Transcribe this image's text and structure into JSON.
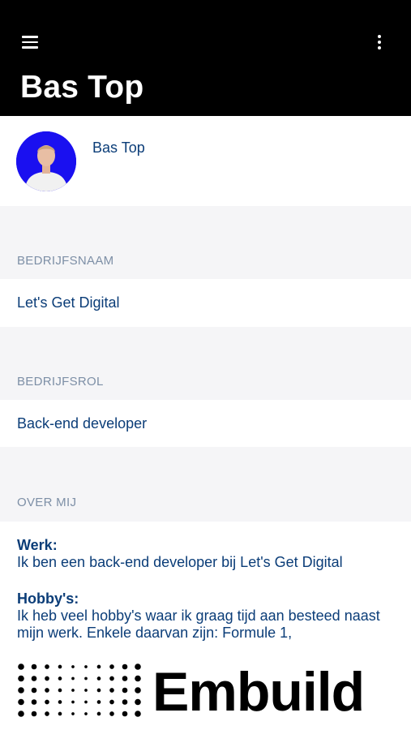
{
  "header": {
    "title": "Bas Top",
    "menu_icon": "hamburger-menu-icon",
    "more_icon": "more-vertical-icon"
  },
  "profile": {
    "name": "Bas Top",
    "avatar_background": "#1a10f0"
  },
  "fields": [
    {
      "label": "BEDRIJFSNAAM",
      "value": "Let's Get Digital"
    },
    {
      "label": "BEDRIJFSROL",
      "value": "Back-end developer"
    }
  ],
  "about": {
    "label": "OVER MIJ",
    "work_heading": "Werk:",
    "work_text": "Ik ben een back-end developer bij Let's Get Digital",
    "hobby_heading": "Hobby's:",
    "hobby_text": "Ik heb veel hobby's waar ik graag tijd aan besteed naast mijn werk. Enkele daarvan zijn: Formule 1,"
  },
  "banner": {
    "brand": "Embuild"
  },
  "colors": {
    "appbar": "#000000",
    "text_primary": "#0b3d78",
    "section_label": "#7d8fa6",
    "background": "#f5f5f7"
  }
}
